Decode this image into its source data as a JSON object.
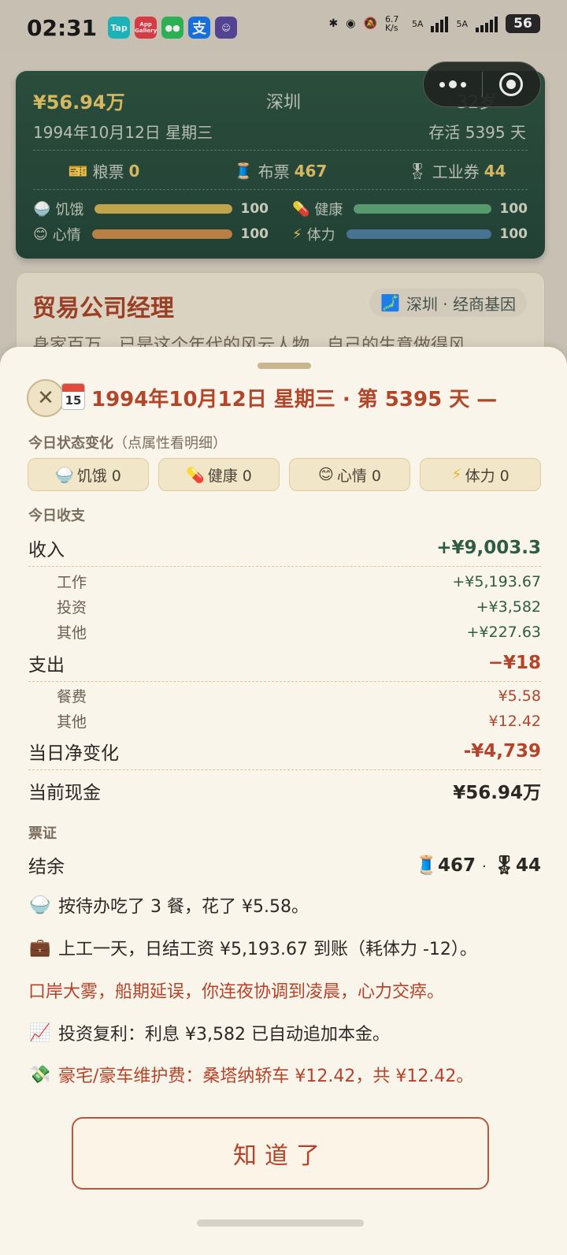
{
  "status_bar": {
    "time": "02:31",
    "apps": [
      "Tap",
      "App Gallery",
      "WeChat",
      "支",
      "avatar"
    ],
    "net_speed": "6.7 K/s",
    "sim1": "5A",
    "sim2": "5A",
    "battery": "56"
  },
  "top_card": {
    "money": "¥56.94万",
    "city": "深圳",
    "age": "32岁",
    "date": "1994年10月12日 星期三",
    "survived": "存活 5395 天",
    "tickets": [
      {
        "icon": "ticket-icon",
        "label": "粮票",
        "value": "0"
      },
      {
        "icon": "thread-icon",
        "label": "布票",
        "value": "467"
      },
      {
        "icon": "medal-icon",
        "label": "工业券",
        "value": "44"
      }
    ],
    "stats": [
      {
        "icon": "rice-icon",
        "label": "饥饿",
        "value": "100",
        "level": 1.0,
        "color": "#d1b253"
      },
      {
        "icon": "pill-icon",
        "label": "健康",
        "value": "100",
        "level": 1.0,
        "color": "#5ea878"
      },
      {
        "icon": "smile-icon",
        "label": "心情",
        "value": "100",
        "level": 1.0,
        "color": "#c98a4b"
      },
      {
        "icon": "bolt-icon",
        "label": "体力",
        "value": "100",
        "level": 1.0,
        "color": "#4f7da0"
      }
    ]
  },
  "job_card": {
    "title": "贸易公司经理",
    "tag": "深圳 · 经商基因",
    "desc": "身家百万，已是这个年代的风云人物，自己的生意做得风"
  },
  "sheet": {
    "title": "1994年10月12日 星期三 · 第 5395 天 —",
    "calendar_day": "15",
    "status_label": "今日状态变化",
    "status_hint": "（点属性看明细）",
    "status_chips": [
      {
        "icon": "rice-icon",
        "label": "饥饿 0"
      },
      {
        "icon": "pill-icon",
        "label": "健康 0"
      },
      {
        "icon": "smile-icon",
        "label": "心情 0"
      },
      {
        "icon": "bolt-icon",
        "label": "体力 0"
      }
    ],
    "finance_label": "今日收支",
    "income": {
      "label": "收入",
      "value": "+¥9,003.3"
    },
    "income_items": [
      {
        "label": "工作",
        "value": "+¥5,193.67"
      },
      {
        "label": "投资",
        "value": "+¥3,582"
      },
      {
        "label": "其他",
        "value": "+¥227.63"
      }
    ],
    "expense": {
      "label": "支出",
      "value": "−¥18"
    },
    "expense_items": [
      {
        "label": "餐费",
        "value": "¥5.58"
      },
      {
        "label": "其他",
        "value": "¥12.42"
      }
    ],
    "net": {
      "label": "当日净变化",
      "value": "-¥4,739"
    },
    "cash": {
      "label": "当前现金",
      "value": "¥56.94万"
    },
    "coupon_label": "票证",
    "balance": {
      "label": "结余",
      "thread": "467",
      "sep": "·",
      "medal": "44"
    },
    "logs": [
      {
        "icon": "rice-icon",
        "text": "按待办吃了 3 餐，花了 ¥5.58。",
        "red": false
      },
      {
        "icon": "briefcase-icon",
        "text": "上工一天，日结工资 ¥5,193.67 到账（耗体力 -12）。",
        "red": false
      },
      {
        "icon": "",
        "text": "口岸大雾，船期延误，你连夜协调到凌晨，心力交瘁。",
        "red": true
      },
      {
        "icon": "chart-up-icon",
        "text": "投资复利：利息 ¥3,582 已自动追加本金。",
        "red": false
      },
      {
        "icon": "money-wings-icon",
        "text": "豪宅/豪车维护费：桑塔纳轿车 ¥12.42，共 ¥12.42。",
        "red": true
      }
    ],
    "ok_button": "知道了"
  }
}
